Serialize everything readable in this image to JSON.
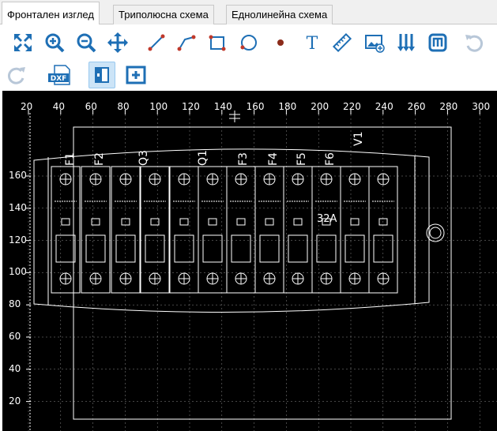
{
  "tabs": [
    {
      "label": "Фронтален изглед",
      "active": true
    },
    {
      "label": "Триполюсна схема",
      "active": false
    },
    {
      "label": "Еднолинейна схема",
      "active": false
    }
  ],
  "toolbar": {
    "row1": [
      "fit-view-icon",
      "zoom-in-icon",
      "zoom-out-icon",
      "pan-icon",
      "line-icon",
      "polyline-icon",
      "rectangle-icon",
      "circle-icon",
      "point-icon",
      "text-icon",
      "ruler-icon",
      "insert-image-icon",
      "distribute-icon",
      "module-icon",
      "undo-icon"
    ],
    "row2": [
      "redo-icon",
      "export-dxf-icon",
      "front-view-icon",
      "add-element-icon"
    ],
    "dxf_label": "DXF",
    "text_glyph": "T"
  },
  "rulers": {
    "x_ticks": [
      "20",
      "40",
      "60",
      "80",
      "100",
      "120",
      "140",
      "160",
      "180",
      "200",
      "220",
      "240",
      "260",
      "280",
      "300"
    ],
    "y_ticks": [
      "160",
      "140",
      "120",
      "100",
      "80",
      "60",
      "40",
      "20"
    ]
  },
  "drawing": {
    "labels": [
      "F1",
      "F2",
      "Q3",
      "Q1",
      "F3",
      "F4",
      "F5",
      "F6",
      "V1"
    ],
    "rating": "32A"
  },
  "colors": {
    "accent": "#1e6fb5",
    "canvas_bg": "#000000",
    "lines": "#ffffff"
  }
}
